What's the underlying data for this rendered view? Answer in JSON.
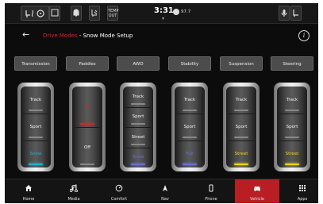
{
  "status_bar": {
    "buttons": [
      {
        "icon": "seat-heat-icon"
      },
      {
        "icon": "steering-heat-icon"
      },
      {
        "icon": "bell-icon"
      },
      {
        "icon": "seat-vent-icon"
      },
      {
        "icon": "temp-out-icon",
        "label": "TEMP OUT"
      }
    ],
    "right_buttons": [
      {
        "icon": "mic-icon"
      },
      {
        "icon": "seat-icon"
      }
    ],
    "time": "3:31",
    "radio": "97.7"
  },
  "header": {
    "back_icon": "back-arrow-icon",
    "title_prefix": "Drive Modes",
    "title_suffix": " - Snow Mode Setup",
    "info_label": "i"
  },
  "categories": [
    "Transmission",
    "Paddles",
    "AWD",
    "Stability",
    "Suspension",
    "Steering"
  ],
  "selectors": [
    {
      "segments": [
        {
          "label": "Track"
        },
        {
          "label": "Sport"
        },
        {
          "label": "Snow",
          "active": true,
          "color": "#1fb3d6"
        }
      ]
    },
    {
      "segments": [
        {
          "label": "On",
          "active": true,
          "color": "#d8242b"
        },
        {
          "label": "Off"
        }
      ]
    },
    {
      "segments": [
        {
          "label": "Track"
        },
        {
          "label": "Sport"
        },
        {
          "label": "Street"
        },
        {
          "label": "Snow",
          "active": true,
          "color": "#6a6fd6"
        }
      ]
    },
    {
      "segments": [
        {
          "label": "Track"
        },
        {
          "label": "Sport"
        },
        {
          "label": "Full",
          "active": true,
          "color": "#6a6fd6"
        }
      ]
    },
    {
      "segments": [
        {
          "label": "Track"
        },
        {
          "label": "Sport"
        },
        {
          "label": "Street",
          "active": true,
          "color": "#f2d40a"
        }
      ]
    },
    {
      "segments": [
        {
          "label": "Track"
        },
        {
          "label": "Sport"
        },
        {
          "label": "Street",
          "active": true,
          "color": "#f2d40a"
        }
      ]
    }
  ],
  "nav": [
    {
      "label": "Home",
      "icon": "home-icon"
    },
    {
      "label": "Media",
      "icon": "music-note-icon"
    },
    {
      "label": "Comfort",
      "icon": "comfort-icon"
    },
    {
      "label": "Nav",
      "icon": "navigation-arrow-icon"
    },
    {
      "label": "Phone",
      "icon": "phone-icon"
    },
    {
      "label": "Vehicle",
      "icon": "car-icon",
      "active": true
    },
    {
      "label": "Apps",
      "icon": "apps-grid-icon"
    }
  ],
  "colors": {
    "accent": "#d8242b",
    "snow": "#1fb3d6",
    "street": "#f2d40a",
    "full": "#6a6fd6"
  }
}
